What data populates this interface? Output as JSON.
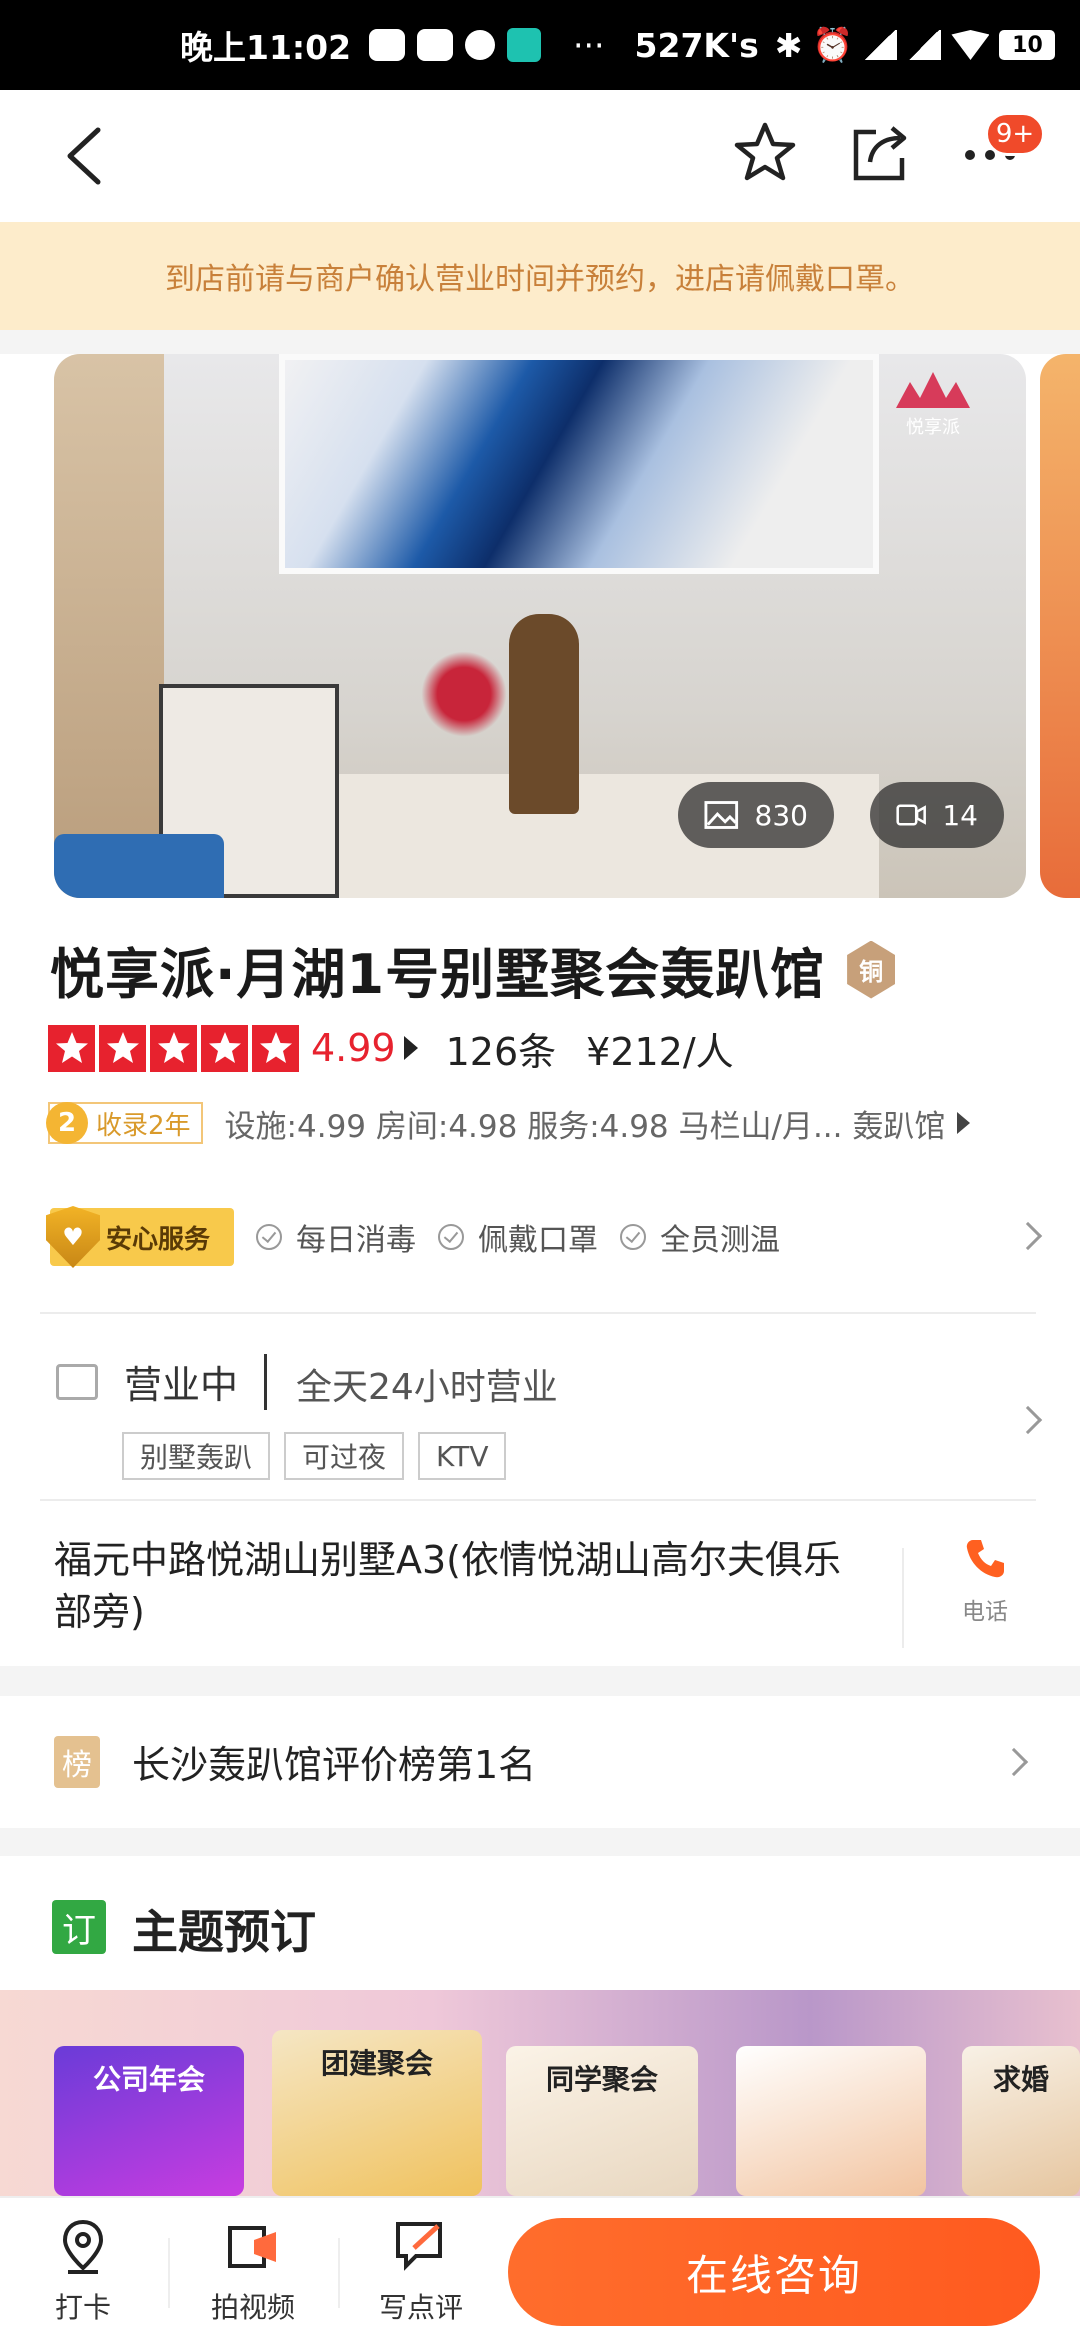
{
  "status_bar": {
    "time": "晚上11:02",
    "net_rate": "527K's",
    "battery": "10",
    "boss_icon_text": "BOSS 直聘"
  },
  "nav": {
    "badge": "9+"
  },
  "notice": "到店前请与商户确认营业时间并预约，进店请佩戴口罩。",
  "gallery": {
    "photo_count": "830",
    "video_count": "14",
    "brand_mark": "悦享派"
  },
  "shop": {
    "title": "悦享派·月湖1号别墅聚会轰趴馆",
    "medal": "铜",
    "rating": "4.99",
    "stars": 5,
    "reviews": "126条",
    "price": "¥212/人",
    "years_num": "2",
    "years_label": "收录2年",
    "sub_scores": "设施:4.99 房间:4.98 服务:4.98 马栏山/月... 轰趴馆"
  },
  "service": {
    "badge_label": "安心服务",
    "items": [
      "每日消毒",
      "佩戴口罩",
      "全员测温"
    ]
  },
  "hours": {
    "status": "营业中",
    "text": "全天24小时营业",
    "tags": [
      "别墅轰趴",
      "可过夜",
      "KTV"
    ]
  },
  "address": {
    "text": "福元中路悦湖山别墅A3(依情悦湖山高尔夫俱乐部旁)",
    "phone_label": "电话"
  },
  "ranking": {
    "icon": "榜",
    "text": "长沙轰趴馆评价榜第1名"
  },
  "themes": {
    "icon": "订",
    "title": "主题预订",
    "items": [
      "公司年会",
      "团建聚会",
      "同学聚会",
      "",
      "求婚"
    ]
  },
  "bottom_bar": {
    "checkin": "打卡",
    "video": "拍视频",
    "review": "写点评",
    "consult": "在线咨询"
  },
  "colors": {
    "accent": "#ff6020",
    "star_red": "#e7222e",
    "notice_bg": "#fdeccb",
    "notice_text": "#c8803a"
  }
}
